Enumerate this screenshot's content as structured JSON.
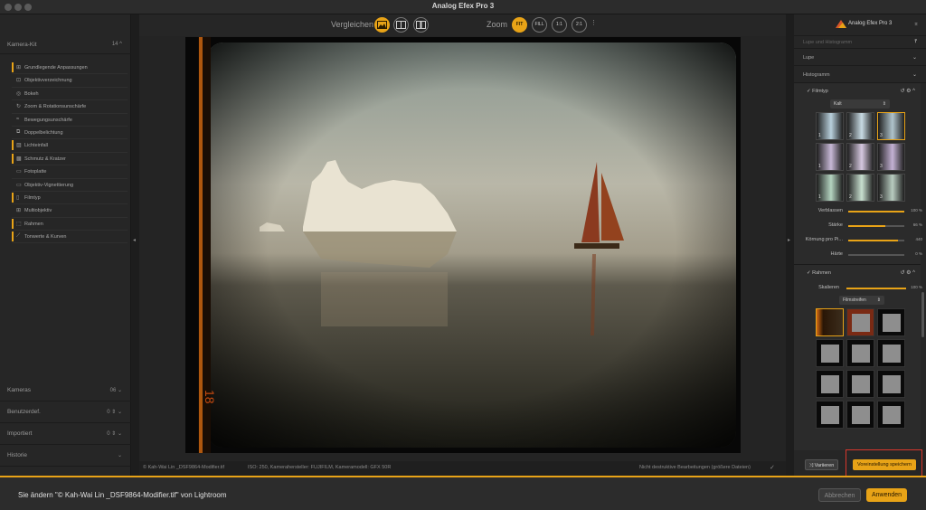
{
  "window": {
    "title": "Analog Efex Pro 3"
  },
  "left_panel": {
    "camera_kit": {
      "label": "Kamera-Kit",
      "count": "14"
    },
    "tools": [
      {
        "label": "Grundlegende Anpassungen",
        "active": true,
        "icon": "⊞"
      },
      {
        "label": "Objektivverzeichnung",
        "active": false,
        "icon": "⊡"
      },
      {
        "label": "Bokeh",
        "active": false,
        "icon": "◎"
      },
      {
        "label": "Zoom & Rotationsunschärfe",
        "active": false,
        "icon": "↻"
      },
      {
        "label": "Bewegungsunschärfe",
        "active": false,
        "icon": "≈"
      },
      {
        "label": "Doppelbelichtung",
        "active": false,
        "icon": "⧉"
      },
      {
        "label": "Lichteinfall",
        "active": true,
        "icon": "▨"
      },
      {
        "label": "Schmutz & Kratzer",
        "active": true,
        "icon": "▩"
      },
      {
        "label": "Fotoplatte",
        "active": false,
        "icon": "▭"
      },
      {
        "label": "Objektiv-Vignettierung",
        "active": false,
        "icon": "▭"
      },
      {
        "label": "Filmtyp",
        "active": true,
        "icon": "▯"
      },
      {
        "label": "Multiobjektiv",
        "active": false,
        "icon": "⊞"
      },
      {
        "label": "Rahmen",
        "active": true,
        "icon": "⬚"
      },
      {
        "label": "Tonwerte & Kurven",
        "active": true,
        "icon": "⟋"
      }
    ],
    "bottom_sections": [
      {
        "label": "Kameras",
        "meta": "06"
      },
      {
        "label": "Benutzerdef.",
        "meta": "0 ⇕"
      },
      {
        "label": "Importiert",
        "meta": "0 ⇕"
      },
      {
        "label": "Historie",
        "meta": ""
      }
    ]
  },
  "toolbar": {
    "compare_label": "Vergleichen",
    "zoom_label": "Zoom",
    "zoom_options": [
      "FIT",
      "FILL",
      "1:1",
      "2:1"
    ]
  },
  "statusbar": {
    "copyright": "© Kah-Wai Lin _DSF9864-Modifier.tif",
    "exif": "ISO: 250, Kamerahersteller: FUJIFILM, Kameramodell: GFX 50R",
    "nondestructive": "Nicht destruktive Bearbeitungen (größere Dateien)"
  },
  "right_panel": {
    "brand": "Analog Efex Pro 3",
    "search_placeholder": "Lupe und Histogramm",
    "loupe": "Lupe",
    "histogram": "Histogramm",
    "filmtype": {
      "title": "Filmtyp",
      "select": "Kalt",
      "thumb_numbers": [
        "1",
        "2",
        "3",
        "1",
        "2",
        "3",
        "1",
        "2",
        "3"
      ],
      "sliders": [
        {
          "label": "Verblassen",
          "value": "100 %",
          "level": 100
        },
        {
          "label": "Stärke",
          "value": "66 %",
          "level": 66
        },
        {
          "label": "Körnung pro Pi...",
          "value": "440",
          "level": 88
        },
        {
          "label": "Härte",
          "value": "0 %",
          "level": 0
        }
      ]
    },
    "frame": {
      "title": "Rahmen",
      "slider_label": "Skalieren",
      "slider_value": "100 %",
      "select": "Filmstreifen"
    },
    "variate_button": "Variieren",
    "save_preset_button": "Voreinstellung speichern"
  },
  "bottom": {
    "message": "Sie ändern \"© Kah-Wai Lin _DSF9864-Modifier.tif\" von Lightroom",
    "cancel": "Abbrechen",
    "apply": "Anwenden"
  },
  "colors": {
    "accent": "#e8a317",
    "highlight_box": "#d9362c"
  }
}
